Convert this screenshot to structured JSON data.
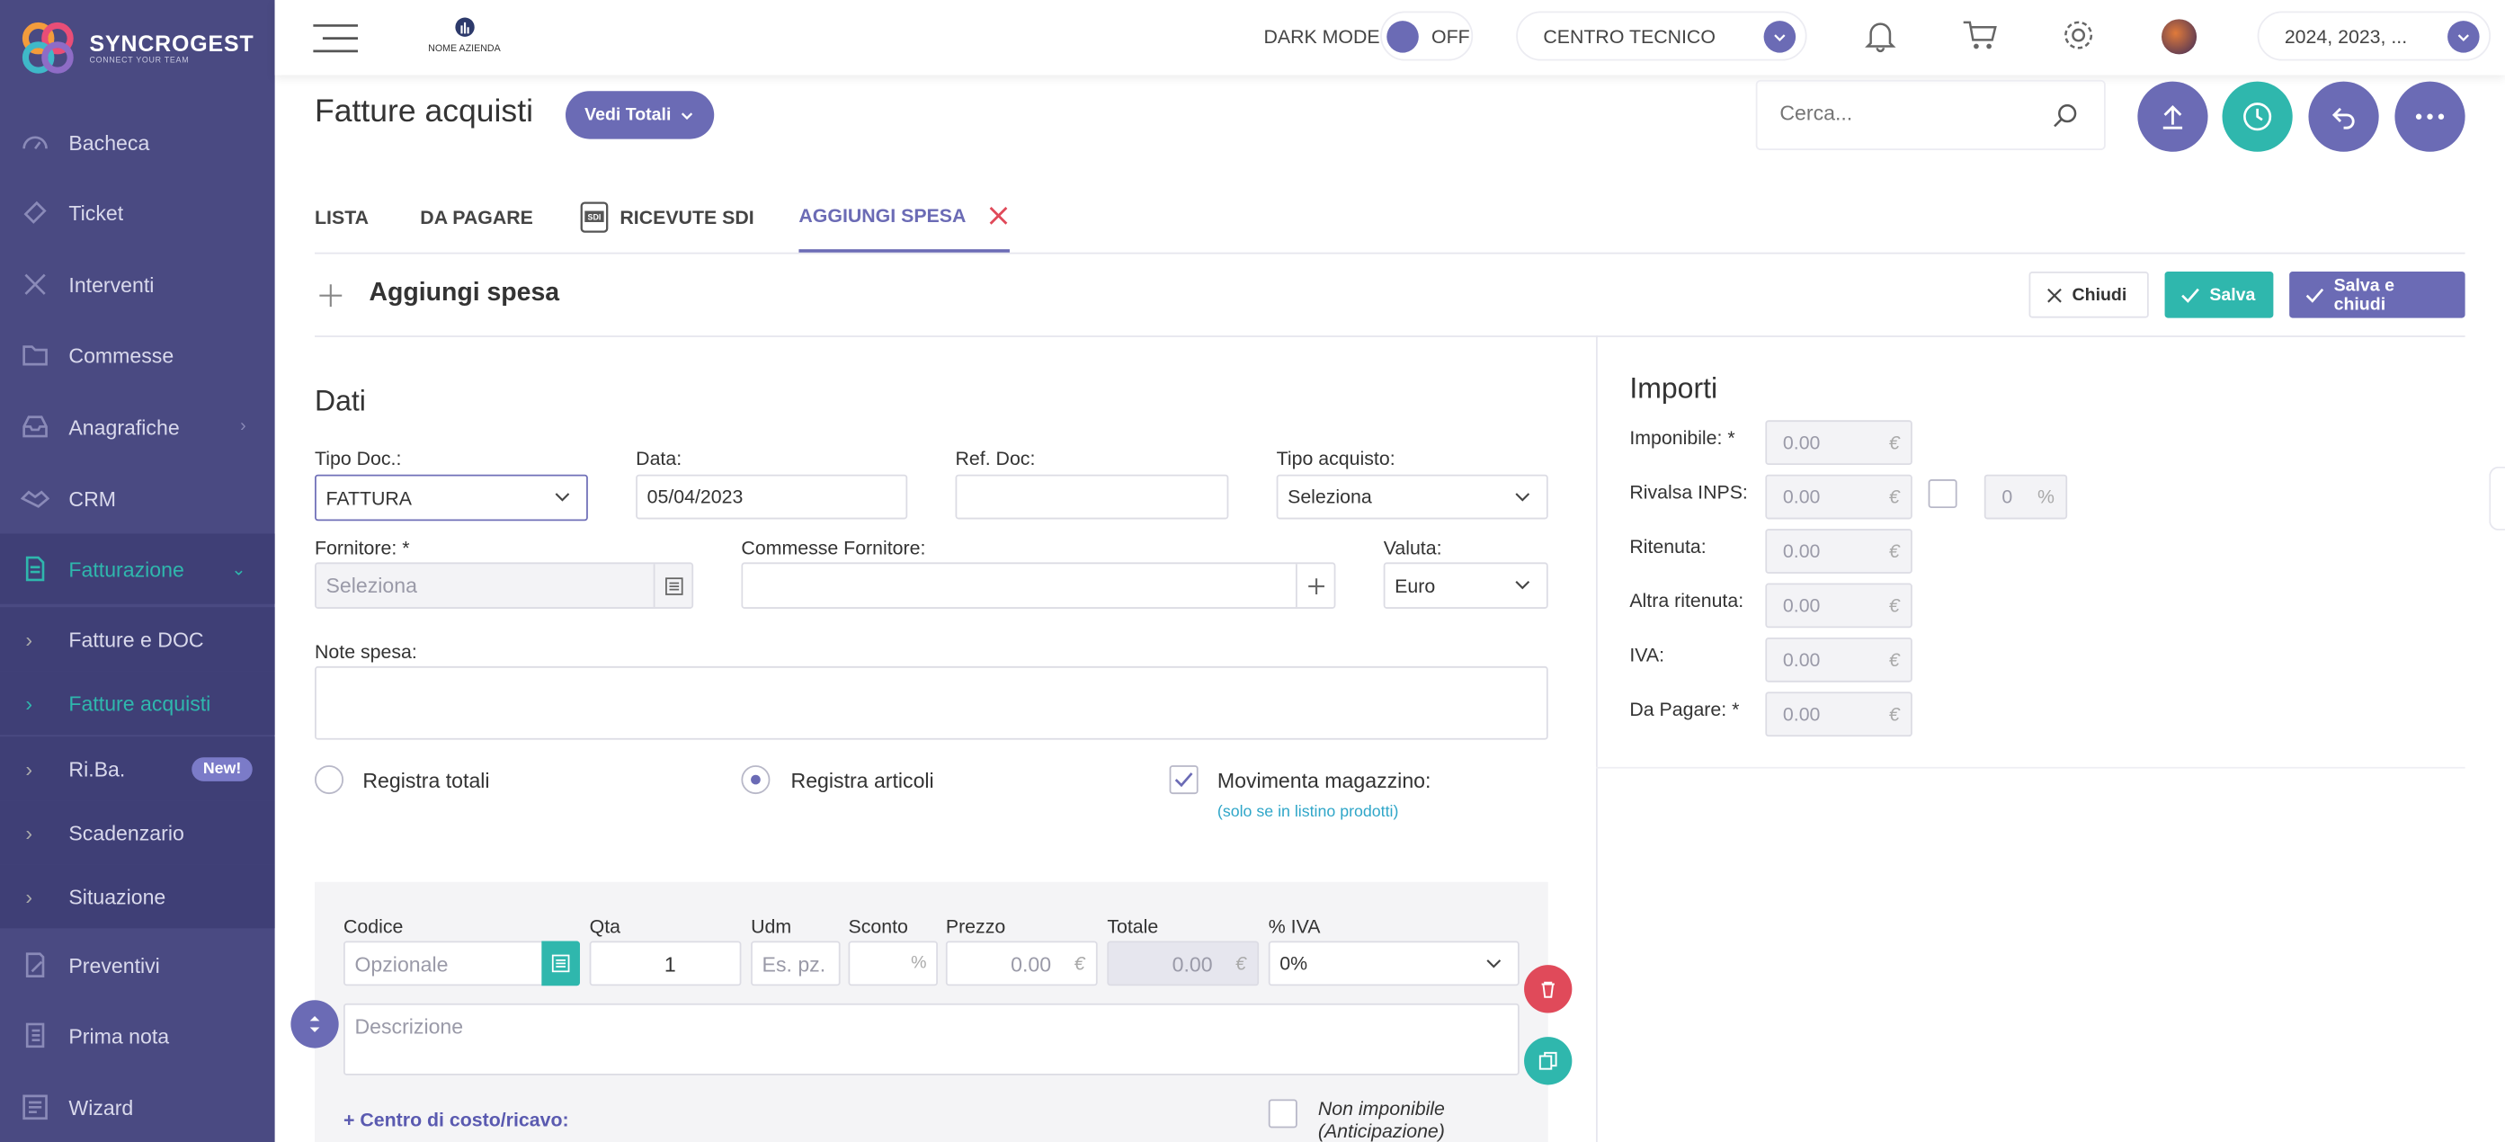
{
  "brand": {
    "name": "SYNCROGEST",
    "tagline": "CONNECT YOUR TEAM"
  },
  "sidebar": {
    "items": [
      {
        "label": "Bacheca",
        "icon": "dashboard-icon"
      },
      {
        "label": "Ticket",
        "icon": "ticket-icon"
      },
      {
        "label": "Interventi",
        "icon": "tools-icon"
      },
      {
        "label": "Commesse",
        "icon": "folder-icon"
      },
      {
        "label": "Anagrafiche",
        "icon": "inbox-icon"
      },
      {
        "label": "CRM",
        "icon": "handshake-icon"
      },
      {
        "label": "Fatturazione",
        "icon": "invoice-icon"
      }
    ],
    "subitems": [
      {
        "label": "Fatture e DOC"
      },
      {
        "label": "Fatture acquisti"
      },
      {
        "label": "Ri.Ba.",
        "badge": "New!"
      },
      {
        "label": "Scadenzario"
      },
      {
        "label": "Situazione"
      }
    ],
    "bottom": [
      {
        "label": "Preventivi",
        "icon": "quote-icon"
      },
      {
        "label": "Prima nota",
        "icon": "notebook-icon"
      },
      {
        "label": "Wizard",
        "icon": "wizard-icon"
      }
    ]
  },
  "topbar": {
    "company": "NOME AZIENDA",
    "dark_mode_label": "DARK MODE",
    "dark_mode_state": "OFF",
    "center": "CENTRO TECNICO",
    "years": "2024, 2023, ..."
  },
  "page": {
    "title": "Fatture acquisti",
    "totals_button": "Vedi Totali",
    "search_placeholder": "Cerca..."
  },
  "tabs": [
    "LISTA",
    "DA PAGARE",
    "RICEVUTE SDI",
    "AGGIUNGI SPESA"
  ],
  "form": {
    "title": "Aggiungi spesa",
    "close": "Chiudi",
    "save": "Salva",
    "save_close": "Salva e chiudi",
    "section": "Dati",
    "tipo_doc_label": "Tipo Doc.:",
    "tipo_doc_value": "FATTURA",
    "data_label": "Data:",
    "data_value": "05/04/2023",
    "ref_label": "Ref. Doc:",
    "tipo_acq_label": "Tipo acquisto:",
    "tipo_acq_value": "Seleziona",
    "fornitore_label": "Fornitore: *",
    "fornitore_placeholder": "Seleziona",
    "commesse_label": "Commesse Fornitore:",
    "valuta_label": "Valuta:",
    "valuta_value": "Euro",
    "note_label": "Note spesa:",
    "radio_totali": "Registra totali",
    "radio_articoli": "Registra articoli",
    "movimenta": "Movimenta magazzino:",
    "movimenta_hint": "(solo se in listino prodotti)"
  },
  "articolo": {
    "codice": "Codice",
    "codice_ph": "Opzionale",
    "qta": "Qta",
    "qta_value": "1",
    "udm": "Udm",
    "udm_ph": "Es. pz.",
    "sconto": "Sconto",
    "sconto_unit": "%",
    "prezzo": "Prezzo",
    "prezzo_value": "0.00",
    "totale": "Totale",
    "totale_value": "0.00",
    "iva": "% IVA",
    "iva_value": "0%",
    "descrizione_ph": "Descrizione",
    "centro": "+ Centro di costo/ricavo:",
    "non_imponibile": "Non imponibile (Anticipazione)",
    "currency": "€"
  },
  "importi": {
    "title": "Importi",
    "rows": [
      {
        "label": "Imponibile: *",
        "value": "0.00"
      },
      {
        "label": "Rivalsa INPS:",
        "value": "0.00"
      },
      {
        "label": "Ritenuta:",
        "value": "0.00"
      },
      {
        "label": "Altra ritenuta:",
        "value": "0.00"
      },
      {
        "label": "IVA:",
        "value": "0.00"
      },
      {
        "label": "Da Pagare: *",
        "value": "0.00"
      }
    ],
    "rivalsa_pct": "0",
    "pct": "%",
    "currency": "€"
  },
  "colors": {
    "sidebar": "#4a4a82",
    "accent": "#6b6bb5",
    "teal": "#2fb7ad",
    "danger": "#e04a5a"
  }
}
